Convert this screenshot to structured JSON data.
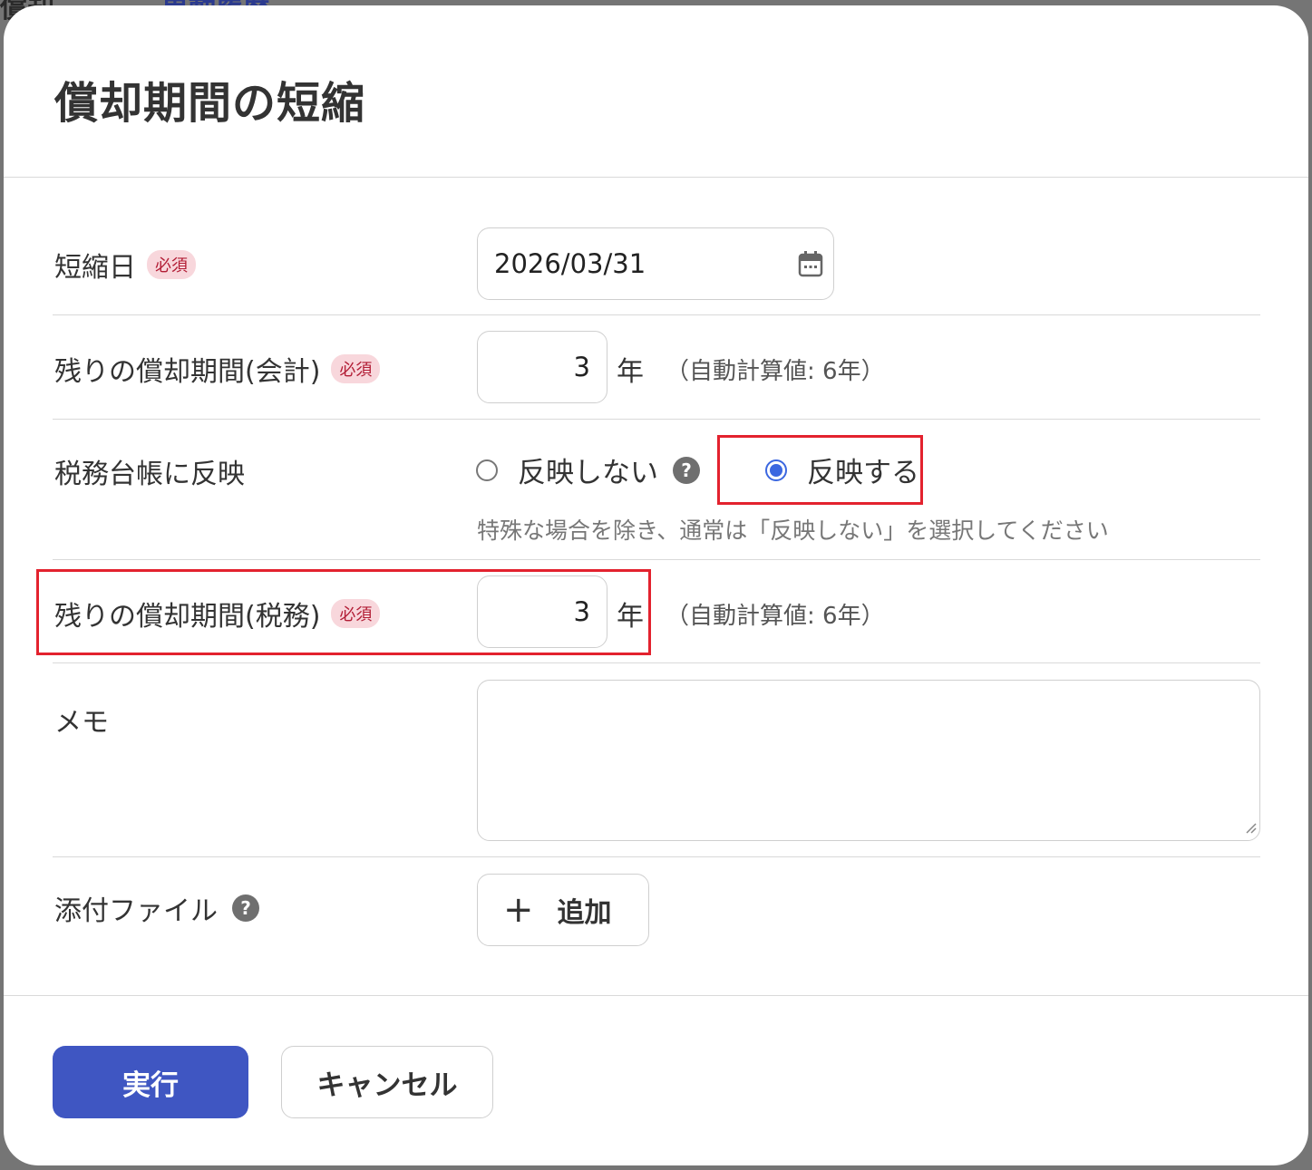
{
  "background": {
    "left_text": "償却",
    "link_text": "異動履歴"
  },
  "dialog": {
    "title": "償却期間の短縮"
  },
  "form": {
    "shorten_date": {
      "label": "短縮日",
      "required": "必須",
      "value": "2026/03/31"
    },
    "remaining_accounting": {
      "label": "残りの償却期間(会計)",
      "required": "必須",
      "value": "3",
      "unit": "年",
      "auto": "（自動計算値: 6年）"
    },
    "tax_ledger": {
      "label": "税務台帳に反映",
      "options": [
        {
          "label": "反映しない",
          "selected": false
        },
        {
          "label": "反映する",
          "selected": true
        }
      ],
      "hint": "特殊な場合を除き、通常は「反映しない」を選択してください"
    },
    "remaining_tax": {
      "label": "残りの償却期間(税務)",
      "required": "必須",
      "value": "3",
      "unit": "年",
      "auto": "（自動計算値: 6年）"
    },
    "memo": {
      "label": "メモ",
      "value": ""
    },
    "attachment": {
      "label": "添付ファイル",
      "add_label": "追加"
    }
  },
  "footer": {
    "execute_label": "実行",
    "cancel_label": "キャンセル"
  },
  "help_symbol": "?",
  "plus_symbol": "+",
  "colors": {
    "primary": "#3f56c2",
    "radio_selected": "#3b67e0",
    "required_bg": "#f8d7dc",
    "required_text": "#b21d35",
    "highlight": "#e3222e",
    "overlay": "#757575"
  }
}
